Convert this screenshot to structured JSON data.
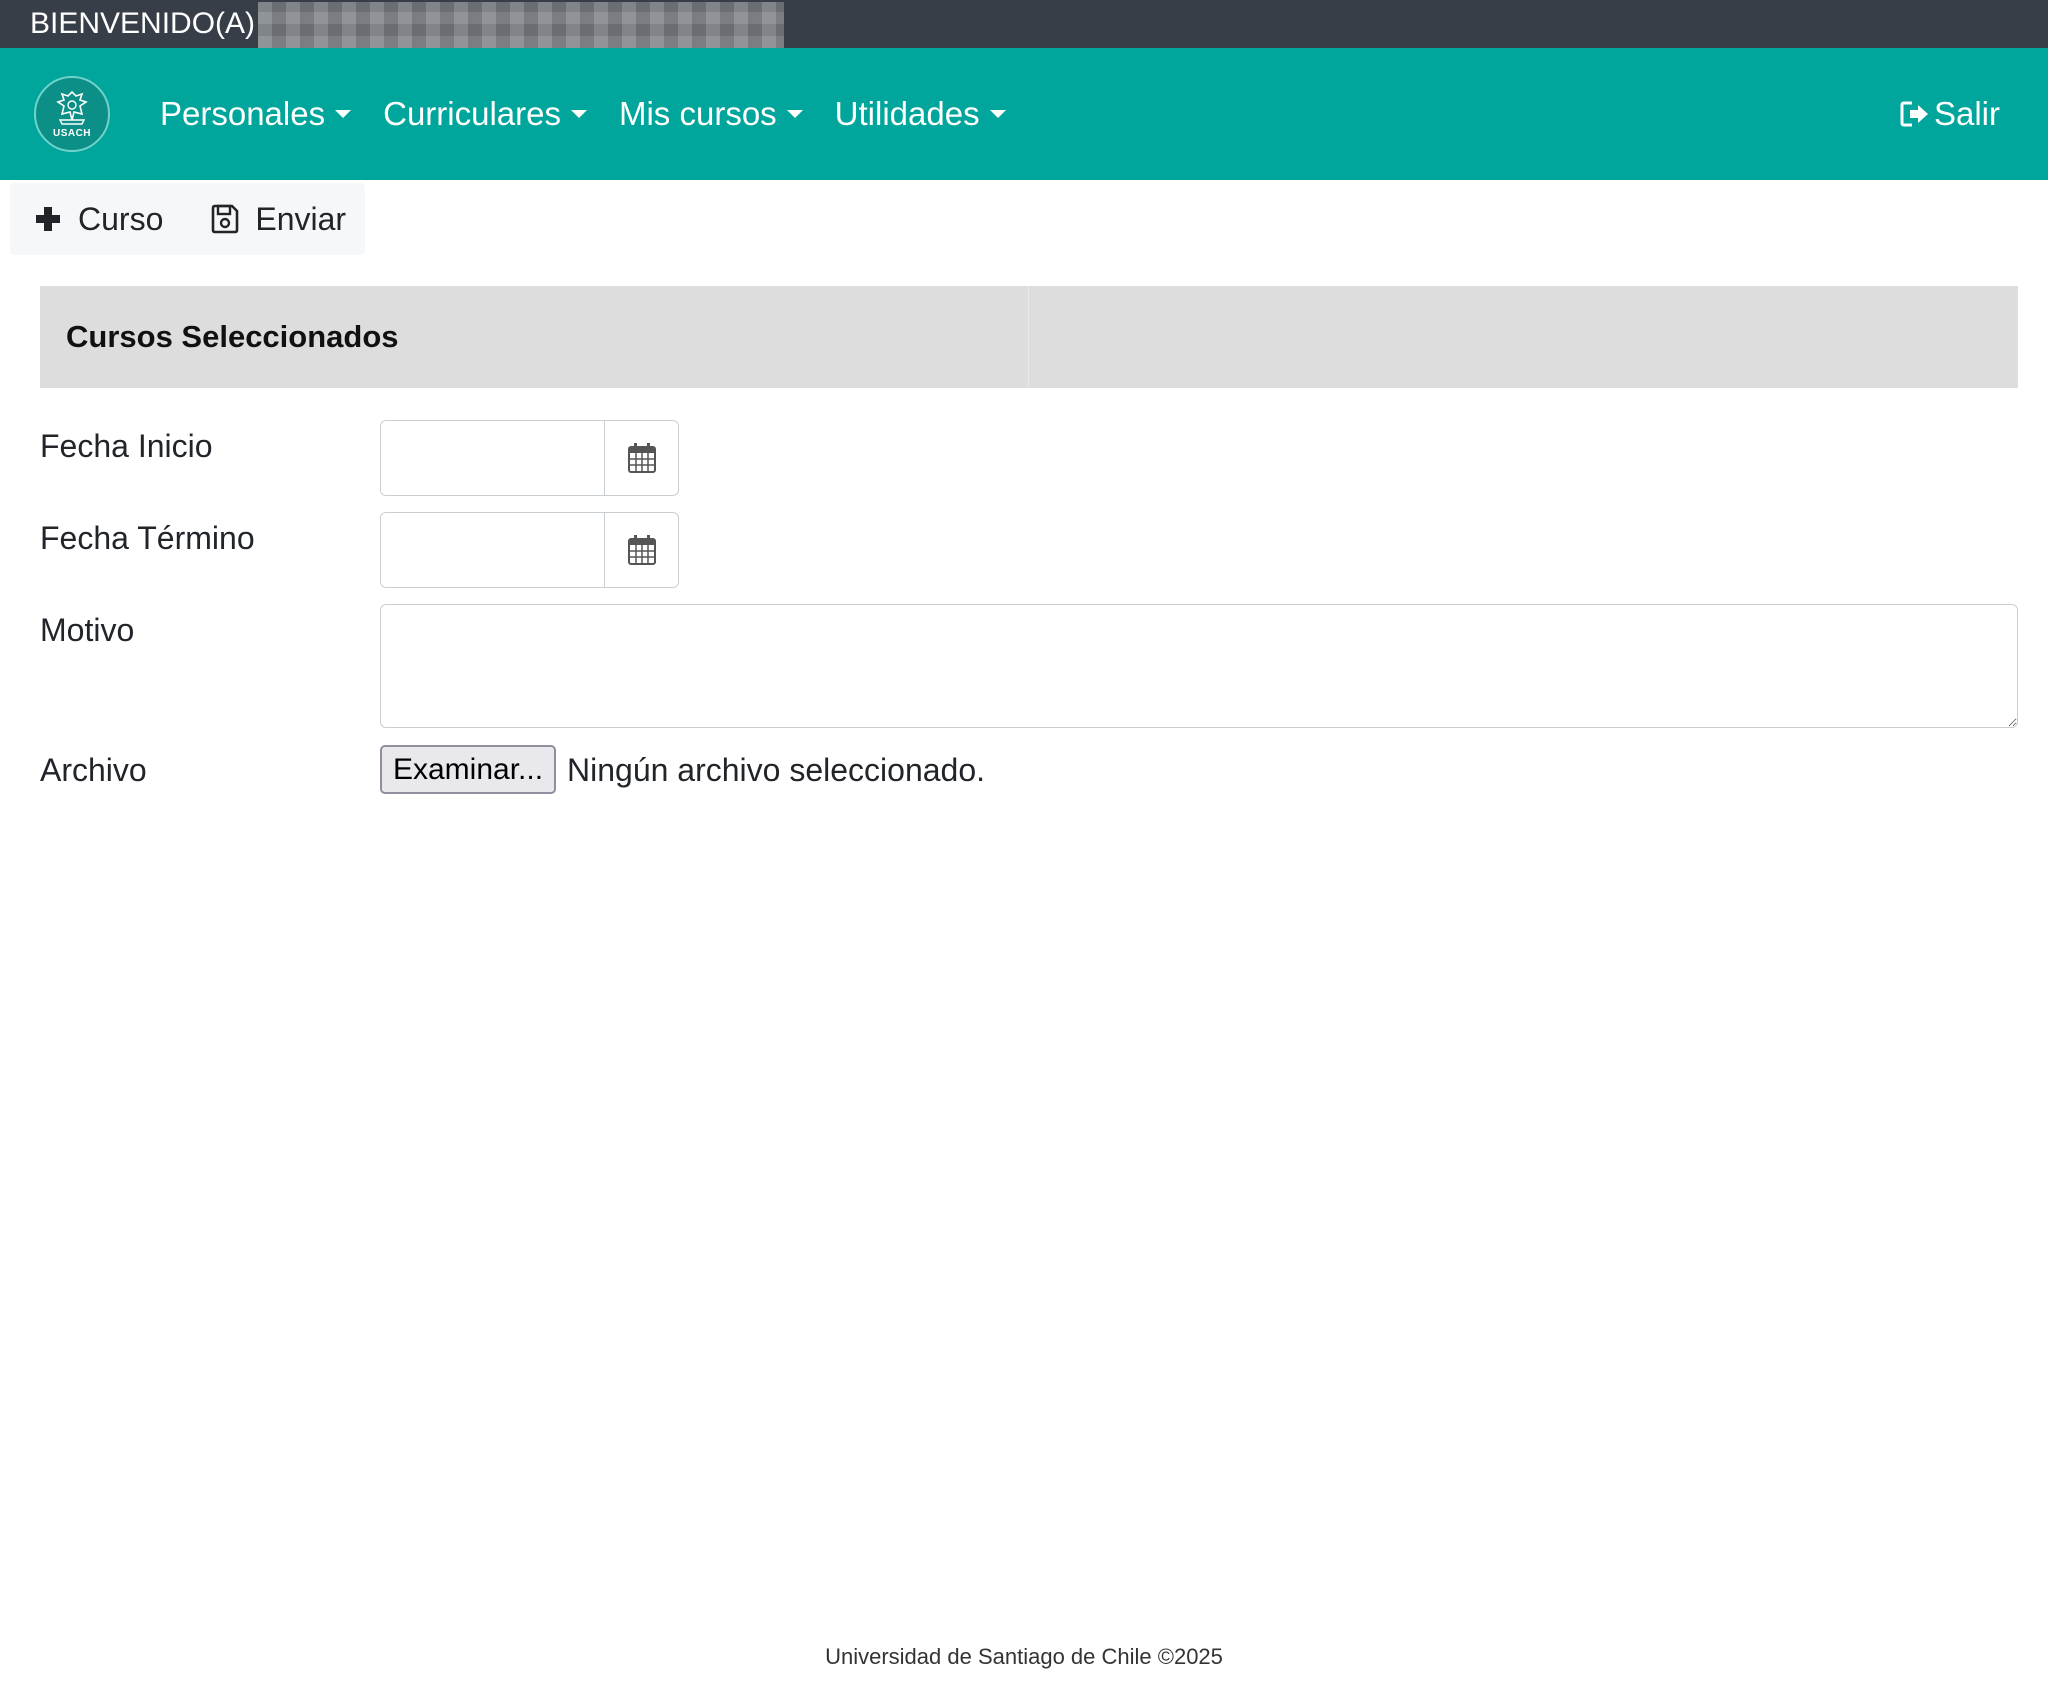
{
  "welcome": {
    "text": "BIENVENIDO(A)"
  },
  "logo": {
    "text": "USACH"
  },
  "nav": {
    "items": [
      {
        "label": "Personales"
      },
      {
        "label": "Curriculares"
      },
      {
        "label": "Mis cursos"
      },
      {
        "label": "Utilidades"
      }
    ],
    "logout_label": "Salir"
  },
  "toolbar": {
    "add_course_label": "Curso",
    "send_label": "Enviar"
  },
  "section": {
    "title": "Cursos Seleccionados"
  },
  "form": {
    "fecha_inicio_label": "Fecha Inicio",
    "fecha_inicio_value": "",
    "fecha_termino_label": "Fecha Término",
    "fecha_termino_value": "",
    "motivo_label": "Motivo",
    "motivo_value": "",
    "archivo_label": "Archivo",
    "file_button_label": "Examinar...",
    "file_status": "Ningún archivo seleccionado."
  },
  "footer": {
    "text": "Universidad de Santiago de Chile ©2025"
  },
  "colors": {
    "navbar": "#00a59b",
    "welcome_bar": "#383e48",
    "section_header": "#dddddd"
  }
}
